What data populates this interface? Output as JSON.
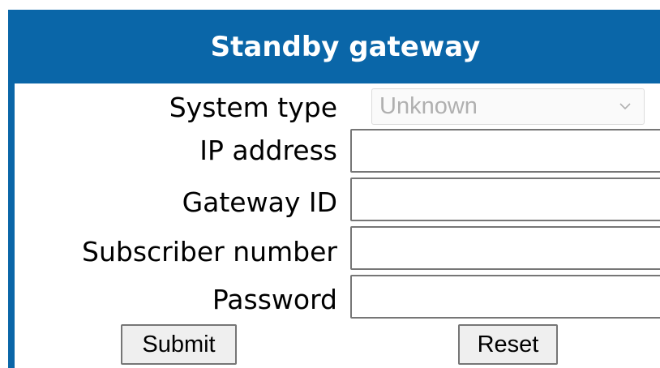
{
  "header": {
    "title": "Standby gateway"
  },
  "form": {
    "system_type": {
      "label": "System type",
      "selected_value": "Unknown"
    },
    "ip_address": {
      "label": "IP address",
      "value": ""
    },
    "gateway_id": {
      "label": "Gateway ID",
      "value": ""
    },
    "subscriber_number": {
      "label": "Subscriber number",
      "value": ""
    },
    "password": {
      "label": "Password",
      "value": ""
    }
  },
  "buttons": {
    "submit_label": "Submit",
    "reset_label": "Reset"
  },
  "colors": {
    "header_bg": "#0a66a8",
    "header_text": "#ffffff"
  },
  "icons": {
    "select_arrow": "chevron-down-icon"
  }
}
